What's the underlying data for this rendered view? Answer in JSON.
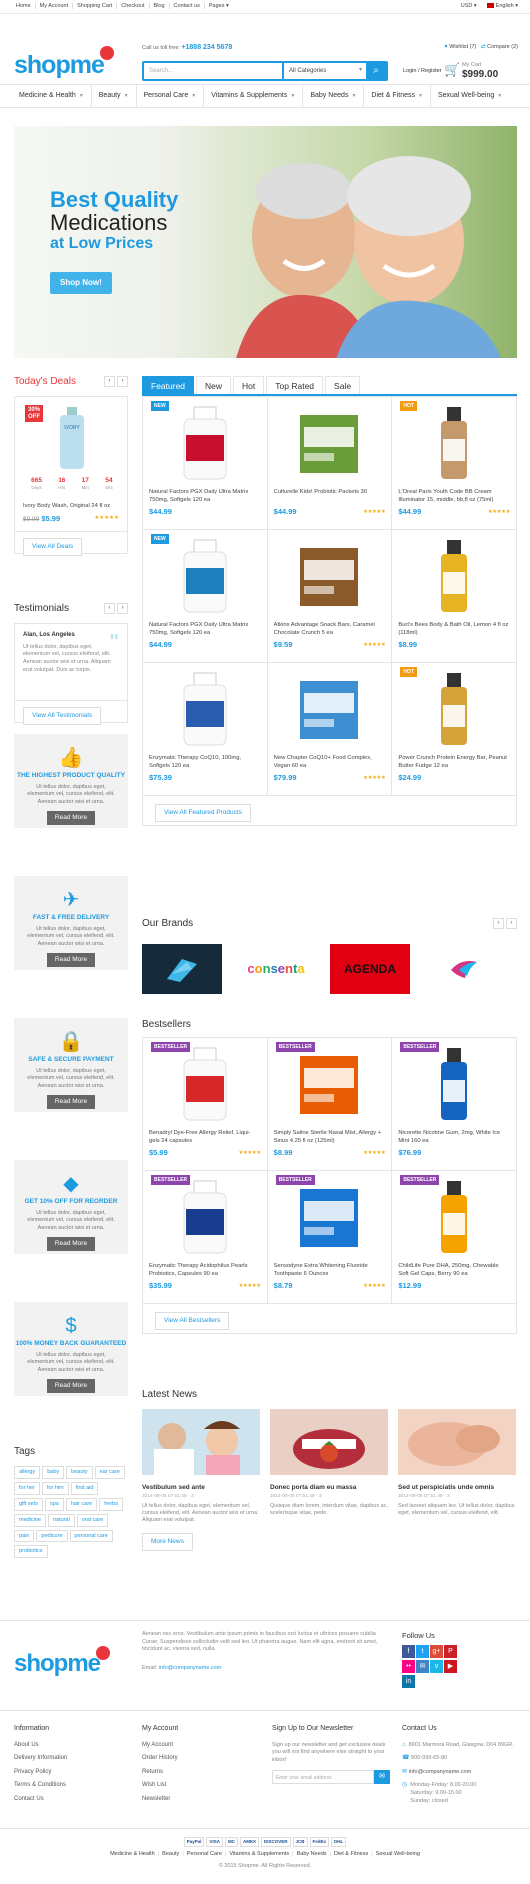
{
  "topbar": {
    "links": [
      "Home",
      "My Account",
      "Shopping Cart",
      "Checkout",
      "Blog",
      "Contact us",
      "Pages"
    ],
    "currency": "USD",
    "language": "English"
  },
  "header": {
    "logo": "shopme",
    "call_label": "Call us toll free:",
    "phone": "+1888 234 5678",
    "search_placeholder": "Search...",
    "category": "All Categories",
    "wishlist": "Wishlist (7)",
    "compare": "Compare (2)",
    "login": "Login / Register",
    "cart_label": "My Cart",
    "cart_total": "$999.00"
  },
  "nav": [
    "Medicine & Health",
    "Beauty",
    "Personal Care",
    "Vitamins & Supplements",
    "Baby Needs",
    "Diet & Fitness",
    "Sexual Well-being"
  ],
  "hero": {
    "line1": "Best Quality",
    "line2": "Medications",
    "line3": "at Low Prices",
    "button": "Shop Now!"
  },
  "deals": {
    "title": "Today's Deals",
    "discount": "30%",
    "discount_label": "OFF",
    "brand": "IVORY",
    "countdown": [
      {
        "value": "665",
        "label": "Days"
      },
      {
        "value": "16",
        "label": "Hrs"
      },
      {
        "value": "17",
        "label": "Min"
      },
      {
        "value": "54",
        "label": "Sec"
      }
    ],
    "name": "Ivory Body Wash, Original 24 fl oz",
    "old_price": "$9.99",
    "price": "$5.99",
    "button": "View All Deals"
  },
  "testimonials": {
    "title": "Testimonials",
    "author": "Alan, Los Angeles",
    "text": "Ut tellus dolor, dapibus eget, elementum vel, cursus eleifend, elit. Aenean auctor wisi et urna. Aliquam erat volutpat. Duis ac turpis.",
    "button": "View All Testimonials"
  },
  "features": [
    {
      "title": "THE HIGHEST PRODUCT QUALITY",
      "text": "Ut tellus dolor, dapibus eget, elementum vel, cursus eleifend, elit. Aenean auctor wisi et urna.",
      "button": "Read More",
      "icon": "thumbs-up"
    },
    {
      "title": "FAST & FREE DELIVERY",
      "text": "Ut tellus dolor, dapibus eget, elementum vel, cursus eleifend, elit. Aenean auctor wisi et urna.",
      "button": "Read More",
      "icon": "paper-plane"
    },
    {
      "title": "SAFE & SECURE PAYMENT",
      "text": "Ut tellus dolor, dapibus eget, elementum vel, cursus eleifend, elit. Aenean auctor wisi et urna.",
      "button": "Read More",
      "icon": "lock"
    },
    {
      "title": "GET 10% OFF FOR REORDER",
      "text": "Ut tellus dolor, dapibus eget, elementum vel, cursus eleifend, elit. Aenean auctor wisi et urna.",
      "button": "Read More",
      "icon": "diamond"
    },
    {
      "title": "100% MONEY BACK GUARANTEED",
      "text": "Ut tellus dolor, dapibus eget, elementum vel, cursus eleifend, elit. Aenean auctor wisi et urna.",
      "button": "Read More",
      "icon": "money"
    }
  ],
  "tags": {
    "title": "Tags",
    "items": [
      "allergy",
      "baby",
      "beauty",
      "ear care",
      "for her",
      "for him",
      "first aid",
      "gift sets",
      "spa",
      "hair care",
      "herbs",
      "medicine",
      "natural",
      "oral care",
      "pain",
      "pedicure",
      "personal care",
      "probiotics"
    ]
  },
  "tabs": [
    "Featured",
    "New",
    "Hot",
    "Top Rated",
    "Sale"
  ],
  "featured": [
    {
      "name": "Natural Factors PGX Daily Ultra Matrix 750mg, Softgels 120 ea",
      "price": "$44.99",
      "badge": "NEW",
      "stars": "",
      "color": "#c8102e"
    },
    {
      "name": "Culturelle Kids! Probiotic Packets 30",
      "price": "$44.99",
      "badge": "",
      "stars": "★★★★★",
      "color": "#6a9c3a"
    },
    {
      "name": "L'Oreal Paris Youth Code BB Cream Illuminator 15, middle, bb,fl oz (75ml)",
      "price": "$44.99",
      "badge": "HOT",
      "stars": "★★★★★",
      "color": "#c49a6c"
    },
    {
      "name": "Natural Factors PGX Daily Ultra Matrix 750mg, Softgels 120 ea",
      "price": "$44.99",
      "badge": "NEW",
      "stars": "",
      "color": "#1e7fbf"
    },
    {
      "name": "Atkins Advantage Snack Bars, Caramel Chocolate Crunch 5 ea",
      "price": "$9.59",
      "badge": "",
      "stars": "★★★★★",
      "color": "#8a5a2b"
    },
    {
      "name": "Burt's Bees Body & Bath Oil, Lemon 4 fl oz (118ml)",
      "price": "$8.99",
      "badge": "",
      "stars": "",
      "color": "#e6b422"
    },
    {
      "name": "Enzymatic Therapy CoQ10, 100mg, Softgels 120 ea",
      "price": "$75.39",
      "badge": "",
      "stars": "",
      "color": "#2a5db0"
    },
    {
      "name": "New Chapter CoQ10+ Food Complex, Vegan 60 ea",
      "price": "$79.99",
      "badge": "",
      "stars": "★★★★★",
      "color": "#3d8fd1"
    },
    {
      "name": "Power Crunch Protein Energy Bar, Peanut Butter Fudge 12 ea",
      "price": "$24.99",
      "badge": "HOT",
      "stars": "",
      "color": "#d4a33a"
    }
  ],
  "featured_button": "View All Featured Products",
  "brands": {
    "title": "Our Brands",
    "items": [
      "",
      "",
      "AGENDA",
      ""
    ]
  },
  "bestsellers": {
    "title": "Bestsellers",
    "button": "View All Bestsellers",
    "items": [
      {
        "name": "Benadryl Dye-Free Allergy Relief, Liqui-gels 24 capsules",
        "price": "$5.99",
        "badge": "BESTSELLER",
        "stars": "★★★★★",
        "color": "#d62828"
      },
      {
        "name": "Simply Saline Sterile Nasal Mist, Allergy + Sinus 4.25 fl oz (125ml)",
        "price": "$8.99",
        "badge": "BESTSELLER",
        "stars": "★★★★★",
        "color": "#e85d04"
      },
      {
        "name": "Nicorette Nicotine Gum, 2mg, White Ice Mint 160 ea",
        "price": "$76.99",
        "badge": "BESTSELLER",
        "stars": "",
        "color": "#1565c0"
      },
      {
        "name": "Enzymatic Therapy Acidophilus Pearls Probiotics, Capsules 90 ea",
        "price": "$35.99",
        "badge": "BESTSELLER",
        "stars": "★★★★★",
        "color": "#1a3c8f"
      },
      {
        "name": "Sensodyne Extra Whitening Fluoride Toothpaste 6 Ounces",
        "price": "$8.79",
        "badge": "BESTSELLER",
        "stars": "★★★★★",
        "color": "#1976d2"
      },
      {
        "name": "ChildLife Pure DHA, 250mg, Chewable Soft Gel Caps, Berry 90 ea",
        "price": "$12.99",
        "badge": "BESTSELLER",
        "stars": "",
        "color": "#f4a300"
      }
    ]
  },
  "news": {
    "title": "Latest News",
    "button": "More News",
    "items": [
      {
        "title": "Vestibulum sed ante",
        "date": "2014-09-05 07:51:49",
        "comments": "3",
        "text": "Ut tellus dolor, dapibus eget, elementum vel, cursus eleifend, elit. Aenean auctor wisi et urna. Aliquam erat volutpat."
      },
      {
        "title": "Donec porta diam eu massa",
        "date": "2014-09-05 07:51:49",
        "comments": "3",
        "text": "Quisque diam lorem, interdum vitae, dapibus ac, scelerisque vitae, pede."
      },
      {
        "title": "Sed ut perspiciatis unde omnis",
        "date": "2014-09-05 07:51:49",
        "comments": "3",
        "text": "Sed laoreet aliquam leo. Ut tellus dolor, dapibus eget, elementum vel, cursus eleifend, elit."
      }
    ]
  },
  "footer": {
    "about": "Aenean nec eros. Vestibulum ante ipsum primis in faucibus orci luctus et ultrices posuere cubilia Curae; Suspendisse sollicitudin velit sed leo. Ut pharetra augue. Nam elit agna, endrerit sit amet, tincidunt ac, viverra sed, nulla.",
    "email_label": "Email:",
    "email": "info@companyname.com",
    "follow": "Follow Us",
    "social": [
      {
        "g": "f",
        "c": "#3b5998"
      },
      {
        "g": "t",
        "c": "#1da1f2"
      },
      {
        "g": "g+",
        "c": "#dd4b39"
      },
      {
        "g": "P",
        "c": "#cb2027"
      },
      {
        "g": "••",
        "c": "#ff0084"
      },
      {
        "g": "✉",
        "c": "#3d85c6"
      },
      {
        "g": "v",
        "c": "#1ab7ea"
      },
      {
        "g": "▶",
        "c": "#cc181e"
      },
      {
        "g": "in",
        "c": "#0e76a8"
      }
    ],
    "information": {
      "title": "Information",
      "items": [
        "About Us",
        "Delivery Information",
        "Privacy Policy",
        "Terms & Conditions",
        "Contact Us"
      ]
    },
    "account": {
      "title": "My Account",
      "items": [
        "My Account",
        "Order History",
        "Returns",
        "Wish List",
        "Newsletter"
      ]
    },
    "newsletter": {
      "title": "Sign Up to Our Newsletter",
      "text": "Sign up our newsletter and get exclusive deals you will not find anywhere else straight to your inbox!",
      "placeholder": "Enter your email address"
    },
    "contact": {
      "title": "Contact Us",
      "address": "8901 Marmora Road, Glasgow, D04 89GR.",
      "phone": "800-999-65-80",
      "email": "info@companyname.com",
      "hours1": "Monday-Friday: 8.00-20.00",
      "hours2": "Saturday: 9.00-15.00",
      "hours3": "Sunday: closed"
    },
    "payments": [
      "PayPal",
      "VISA",
      "MC",
      "AMEX",
      "DISCOVER",
      "JCB",
      "FedEx",
      "DHL"
    ],
    "bottom_links": [
      "Medicine & Health",
      "Beauty",
      "Personal Care",
      "Vitamins & Supplements",
      "Baby Needs",
      "Diet & Fitness",
      "Sexual Well-being"
    ],
    "copyright": "© 2015 Shopme. All Rights Reserved."
  }
}
